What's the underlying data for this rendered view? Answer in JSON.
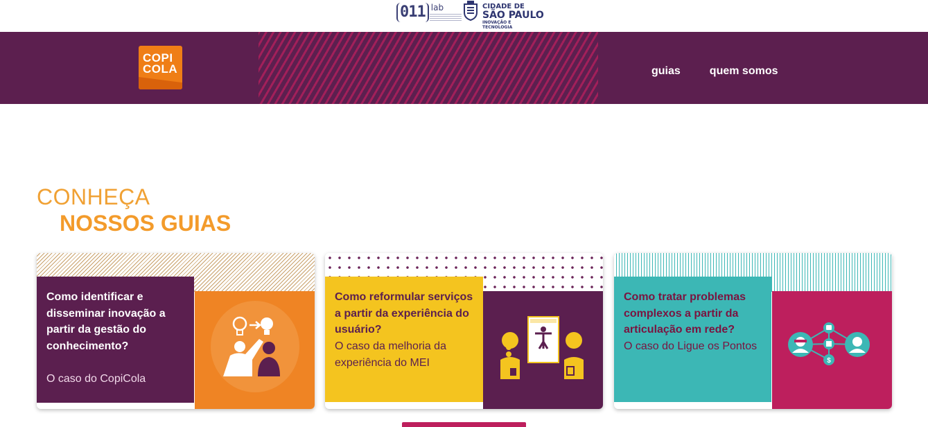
{
  "partners": {
    "lab_logo": {
      "num": "011",
      "suffix": "lab"
    },
    "city_logo": {
      "line1": "CIDADE DE",
      "line2": "SÃO PAULO",
      "line3": "INOVAÇÃO E",
      "line4": "TECNOLOGIA"
    }
  },
  "header": {
    "brand": {
      "line1": "COPI",
      "line2": "COLA"
    },
    "nav": [
      {
        "label": "guias"
      },
      {
        "label": "quem somos"
      }
    ]
  },
  "main": {
    "heading": {
      "line1": "CONHEÇA",
      "line2": "NOSSOS GUIAS"
    },
    "cards": [
      {
        "question": "Como identificar e disseminar inovação a partir da gestão do conhecimento?",
        "case": "O caso do CopiCola",
        "illustration": "lightbulb-people-icon"
      },
      {
        "question": "Como reformular serviços a partir da experiência do usuário?",
        "case": "O caso da melhoria da experiência do MEI",
        "illustration": "user-experience-icon"
      },
      {
        "question": "Como tratar problemas complexos a partir da articulação em rede?",
        "case": "O caso do Ligue os Pontos",
        "illustration": "network-people-icon"
      }
    ]
  },
  "colors": {
    "header_bg": "#5c1f4f",
    "accent_orange": "#f39b2b",
    "card_purple": "#5b1f4f",
    "card_yellow": "#f4c41f",
    "card_teal": "#3cb7b5",
    "card_magenta": "#bd1f5d"
  }
}
